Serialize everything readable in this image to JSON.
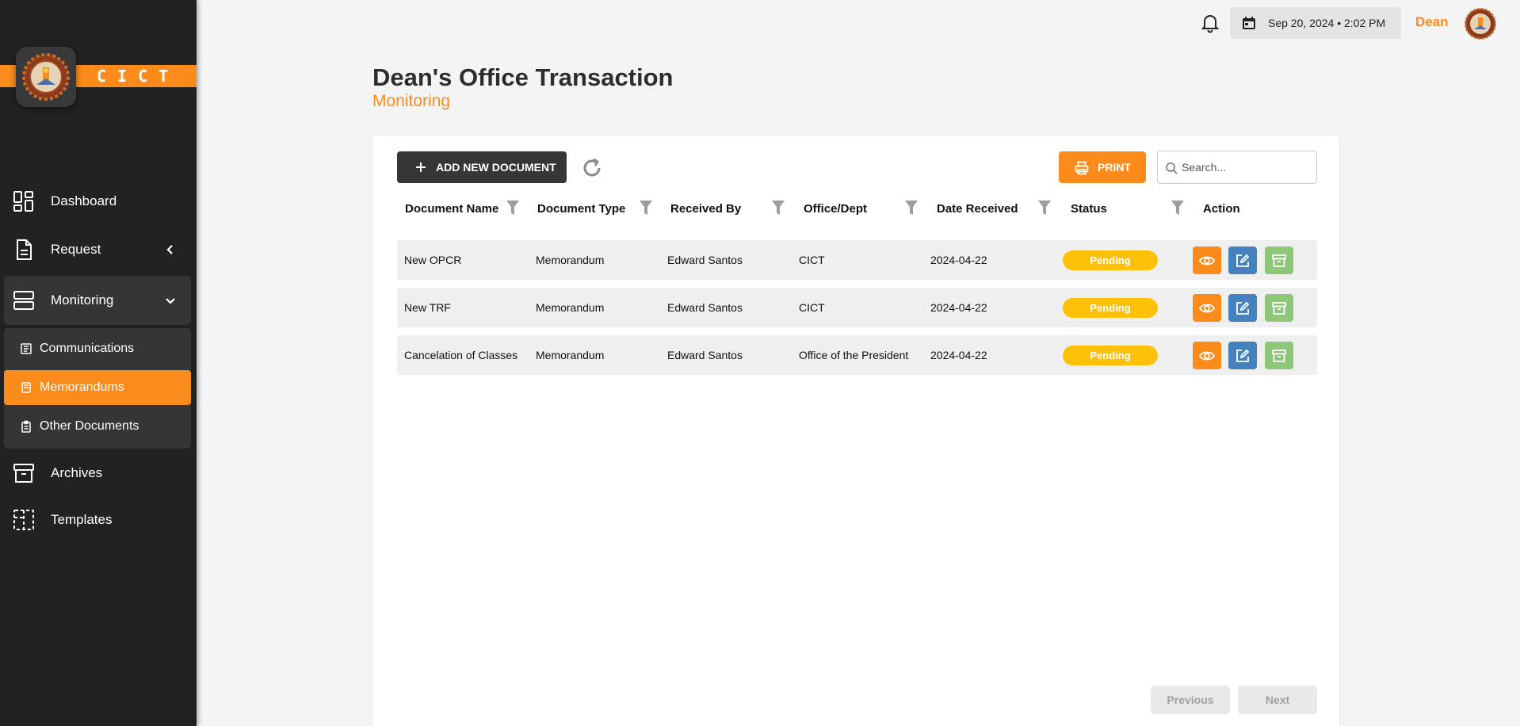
{
  "brand": {
    "name": "CICT"
  },
  "sidebar": {
    "items": [
      {
        "key": "dashboard",
        "label": "Dashboard"
      },
      {
        "key": "request",
        "label": "Request"
      },
      {
        "key": "monitoring",
        "label": "Monitoring"
      },
      {
        "key": "archives",
        "label": "Archives"
      },
      {
        "key": "templates",
        "label": "Templates"
      }
    ],
    "monitoring_sub": [
      {
        "label": "Communications"
      },
      {
        "label": "Memorandums",
        "active": true
      },
      {
        "label": "Other Documents"
      }
    ]
  },
  "topbar": {
    "date": "Sep 20, 2024",
    "time": "2:02 PM",
    "separator": "•",
    "user": "Dean"
  },
  "header": {
    "title": "Dean's Office Transaction",
    "subtitle": "Monitoring"
  },
  "toolbar": {
    "add_label": "ADD NEW DOCUMENT",
    "print_label": "PRINT",
    "search_placeholder": "Search..."
  },
  "table": {
    "columns": [
      "Document Name",
      "Document Type",
      "Received By",
      "Office/Dept",
      "Date Received",
      "Status",
      "Action"
    ],
    "rows": [
      {
        "name": "New OPCR",
        "type": "Memorandum",
        "received_by": "Edward Santos",
        "office": "CICT",
        "date": "2024-04-22",
        "status": "Pending"
      },
      {
        "name": "New TRF",
        "type": "Memorandum",
        "received_by": "Edward Santos",
        "office": "CICT",
        "date": "2024-04-22",
        "status": "Pending"
      },
      {
        "name": "Cancelation of Classes",
        "type": "Memorandum",
        "received_by": "Edward Santos",
        "office": "Office of the President",
        "date": "2024-04-22",
        "status": "Pending"
      }
    ]
  },
  "pagination": {
    "previous": "Previous",
    "next": "Next"
  },
  "colors": {
    "accent": "#fb8c1c",
    "sidebar": "#232222",
    "pending": "#ffc107",
    "edit": "#4582bd",
    "archive": "#8ec77a"
  }
}
